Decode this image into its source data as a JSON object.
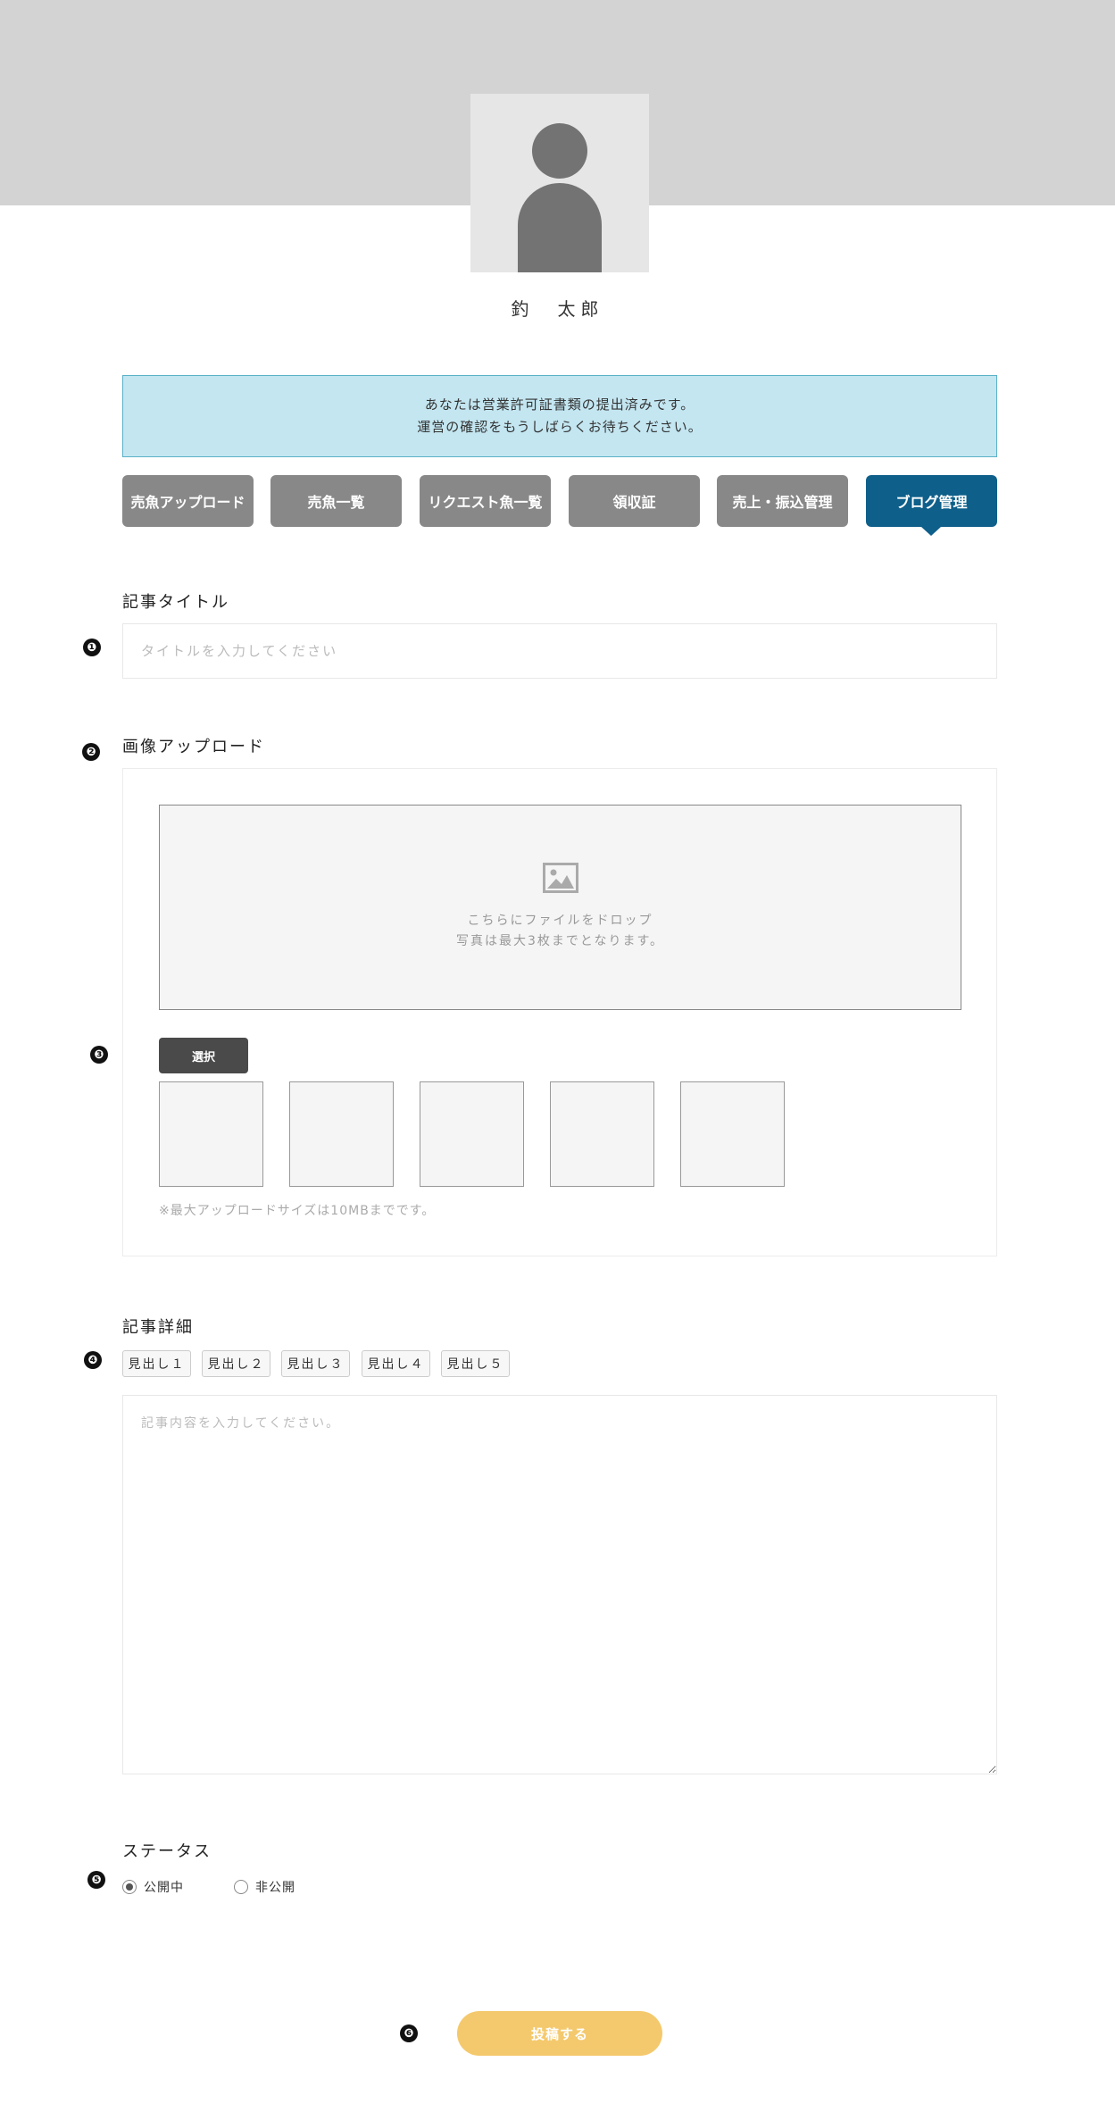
{
  "profile": {
    "name": "釣　太郎"
  },
  "notice": {
    "line1": "あなたは営業許可証書類の提出済みです。",
    "line2": "運営の確認をもうしばらくお待ちください。"
  },
  "tabs": [
    {
      "label": "売魚アップロード",
      "active": false
    },
    {
      "label": "売魚一覧",
      "active": false
    },
    {
      "label": "リクエスト魚一覧",
      "active": false
    },
    {
      "label": "領収証",
      "active": false
    },
    {
      "label": "売上・振込管理",
      "active": false
    },
    {
      "label": "ブログ管理",
      "active": true
    }
  ],
  "markers": [
    "❶",
    "❷",
    "❸",
    "❹",
    "❺",
    "❻"
  ],
  "article_title": {
    "label": "記事タイトル",
    "placeholder": "タイトルを入力してください",
    "value": ""
  },
  "image_upload": {
    "label": "画像アップロード",
    "drop_line1": "こちらにファイルをドロップ",
    "drop_line2": "写真は最大3枚までとなります。",
    "select_label": "選択",
    "note": "※最大アップロードサイズは10MBまでです。",
    "thumbnail_count": 5
  },
  "article_detail": {
    "label": "記事詳細",
    "heading_buttons": [
      "見出し１",
      "見出し２",
      "見出し３",
      "見出し４",
      "見出し５"
    ],
    "placeholder": "記事内容を入力してください。",
    "value": ""
  },
  "status": {
    "label": "ステータス",
    "options": [
      {
        "label": "公開中",
        "checked": true
      },
      {
        "label": "非公開",
        "checked": false
      }
    ]
  },
  "submit": {
    "label": "投稿する"
  },
  "colors": {
    "hero_bg": "#d3d3d3",
    "notice_bg": "#c3e6f1",
    "notice_border": "#5ab1c7",
    "tab_default": "#888888",
    "tab_active": "#0e5f8a",
    "submit_bg": "#f4c96d"
  }
}
